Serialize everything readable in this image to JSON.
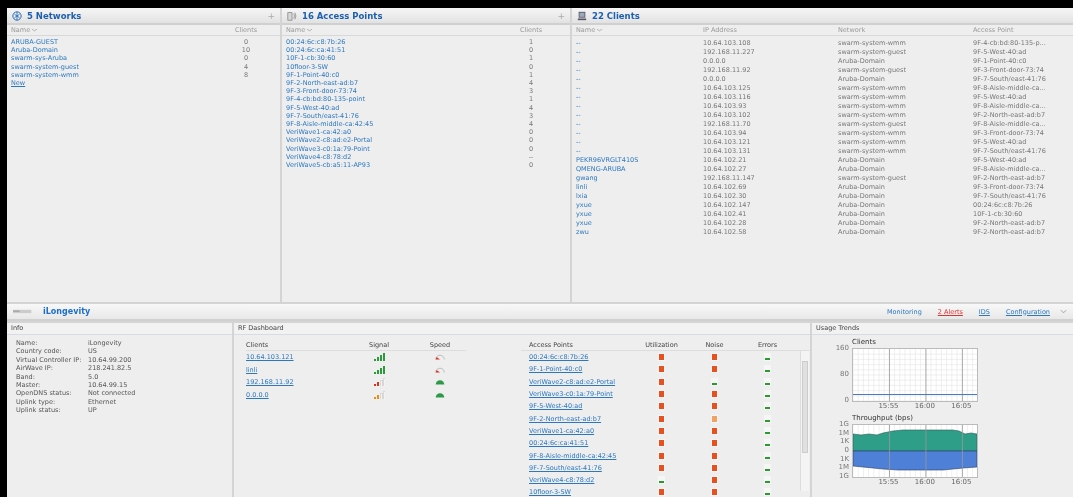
{
  "networks": {
    "title": "5 Networks",
    "add": "+",
    "columns": [
      "Name",
      "Clients"
    ],
    "rows": [
      {
        "name": "ARUBA-GUEST",
        "clients": "0"
      },
      {
        "name": "Aruba-Domain",
        "clients": "10"
      },
      {
        "name": "swarm-sys-Aruba",
        "clients": "0"
      },
      {
        "name": "swarm-system-guest",
        "clients": "4"
      },
      {
        "name": "swarm-system-wmm",
        "clients": "8"
      }
    ],
    "new_link": "New"
  },
  "access_points": {
    "title": "16 Access Points",
    "add": "+",
    "columns": [
      "Name",
      "Clients"
    ],
    "rows": [
      {
        "name": "00:24:6c:c8:7b:26",
        "clients": "1"
      },
      {
        "name": "00:24:6c:ca:41:51",
        "clients": "0"
      },
      {
        "name": "10F-1-cb:30:60",
        "clients": "1"
      },
      {
        "name": "10floor-3-SW",
        "clients": "0"
      },
      {
        "name": "9F-1-Point-40:c0",
        "clients": "1"
      },
      {
        "name": "9F-2-North-east-ad:b7",
        "clients": "4"
      },
      {
        "name": "9F-3-Front-door-73:74",
        "clients": "3"
      },
      {
        "name": "9F-4-cb:bd:80-135-point",
        "clients": "1"
      },
      {
        "name": "9F-5-West-40:ad",
        "clients": "4"
      },
      {
        "name": "9F-7-South/east-41:76",
        "clients": "3"
      },
      {
        "name": "9F-8-Aisle-middle-ca:42:45",
        "clients": "4"
      },
      {
        "name": "VeriWave1-ca:42:a0",
        "clients": "0"
      },
      {
        "name": "VeriWave2-c8:ad:e2-Portal",
        "clients": "0"
      },
      {
        "name": "VeriWave3-c0:1a:79-Point",
        "clients": "0"
      },
      {
        "name": "VeriWave4-c8:78:d2",
        "clients": "--"
      },
      {
        "name": "VeriWave5-cb:a5:11-AP93",
        "clients": "0"
      }
    ]
  },
  "clients": {
    "title": "22 Clients",
    "columns": [
      "Name",
      "IP Address",
      "Network",
      "Access Point"
    ],
    "rows": [
      {
        "name": "--",
        "ip": "10.64.103.108",
        "network": "swarm-system-wmm",
        "access_point": "9F-4-cb:bd:80-135-p..."
      },
      {
        "name": "--",
        "ip": "192.168.11.227",
        "network": "swarm-system-guest",
        "access_point": "9F-5-West-40:ad"
      },
      {
        "name": "--",
        "ip": "0.0.0.0",
        "network": "Aruba-Domain",
        "access_point": "9F-1-Point-40:c0"
      },
      {
        "name": "--",
        "ip": "192.168.11.92",
        "network": "swarm-system-guest",
        "access_point": "9F-3-Front-door-73:74"
      },
      {
        "name": "--",
        "ip": "0.0.0.0",
        "network": "Aruba-Domain",
        "access_point": "9F-7-South/east-41:76"
      },
      {
        "name": "--",
        "ip": "10.64.103.125",
        "network": "swarm-system-wmm",
        "access_point": "9F-8-Aisle-middle-ca..."
      },
      {
        "name": "--",
        "ip": "10.64.103.116",
        "network": "swarm-system-wmm",
        "access_point": "9F-5-West-40:ad"
      },
      {
        "name": "--",
        "ip": "10.64.103.93",
        "network": "swarm-system-wmm",
        "access_point": "9F-8-Aisle-middle-ca..."
      },
      {
        "name": "--",
        "ip": "10.64.103.102",
        "network": "swarm-system-wmm",
        "access_point": "9F-2-North-east-ad:b7"
      },
      {
        "name": "--",
        "ip": "192.168.11.70",
        "network": "swarm-system-guest",
        "access_point": "9F-8-Aisle-middle-ca..."
      },
      {
        "name": "--",
        "ip": "10.64.103.94",
        "network": "swarm-system-wmm",
        "access_point": "9F-3-Front-door-73:74"
      },
      {
        "name": "--",
        "ip": "10.64.103.121",
        "network": "swarm-system-wmm",
        "access_point": "9F-5-West-40:ad"
      },
      {
        "name": "--",
        "ip": "10.64.103.131",
        "network": "swarm-system-wmm",
        "access_point": "9F-7-South/east-41:76"
      },
      {
        "name": "PEKR96VRGLT410S",
        "ip": "10.64.102.21",
        "network": "Aruba-Domain",
        "access_point": "9F-5-West-40:ad"
      },
      {
        "name": "QMENG-ARUBA",
        "ip": "10.64.102.27",
        "network": "Aruba-Domain",
        "access_point": "9F-8-Aisle-middle-ca..."
      },
      {
        "name": "gwang",
        "ip": "192.168.11.147",
        "network": "swarm-system-guest",
        "access_point": "9F-2-North-east-ad:b7"
      },
      {
        "name": "linli",
        "ip": "10.64.102.69",
        "network": "Aruba-Domain",
        "access_point": "9F-3-Front-door-73:74"
      },
      {
        "name": "lxia",
        "ip": "10.64.102.30",
        "network": "Aruba-Domain",
        "access_point": "9F-7-South/east-41:76"
      },
      {
        "name": "yxue",
        "ip": "10.64.102.147",
        "network": "Aruba-Domain",
        "access_point": "00:24:6c:c8:7b:26"
      },
      {
        "name": "yxue",
        "ip": "10.64.102.41",
        "network": "Aruba-Domain",
        "access_point": "10F-1-cb:30:60"
      },
      {
        "name": "yxue",
        "ip": "10.64.102.28",
        "network": "Aruba-Domain",
        "access_point": "9F-2-North-east-ad:b7"
      },
      {
        "name": "zwu",
        "ip": "10.64.102.58",
        "network": "Aruba-Domain",
        "access_point": "9F-2-North-east-ad:b7"
      }
    ]
  },
  "controller": {
    "title": "iLongevity",
    "nav": [
      {
        "label": "Monitoring",
        "selected": true,
        "kind": "link"
      },
      {
        "label": "2 Alerts",
        "selected": false,
        "kind": "alert"
      },
      {
        "label": "IDS",
        "selected": false,
        "kind": "link"
      },
      {
        "label": "Configuration",
        "selected": false,
        "kind": "link"
      }
    ]
  },
  "info": {
    "title": "Info",
    "fields": [
      {
        "label": "Name:",
        "value": "iLongevity"
      },
      {
        "label": "Country code:",
        "value": "US"
      },
      {
        "label": "Virtual Controller IP:",
        "value": "10.64.99.200"
      },
      {
        "label": "AirWave IP:",
        "value": "218.241.82.5"
      },
      {
        "label": "Band:",
        "value": "5.0"
      },
      {
        "label": "Master:",
        "value": "10.64.99.15"
      },
      {
        "label": "OpenDNS status:",
        "value": "Not connected"
      },
      {
        "label": "Uplink type:",
        "value": "Ethernet"
      },
      {
        "label": "Uplink status:",
        "value": "UP"
      }
    ]
  },
  "rf_dashboard": {
    "title": "RF Dashboard",
    "client_columns": [
      "Clients",
      "Signal",
      "Speed"
    ],
    "clients": [
      {
        "name": "10.64.103.121",
        "signal": {
          "strong": true,
          "color": "#2c9a3a"
        },
        "fast": false
      },
      {
        "name": "linli",
        "signal": {
          "strong": true,
          "color": "#2c9a3a"
        },
        "fast": false
      },
      {
        "name": "192.168.11.92",
        "signal": {
          "strong": false,
          "color": "#e03020"
        },
        "fast": true
      },
      {
        "name": "0.0.0.0",
        "signal": {
          "strong": false,
          "color": "#f08a10"
        },
        "fast": true
      }
    ],
    "ap_columns": [
      "Access Points",
      "Utilization",
      "Noise",
      "Errors"
    ],
    "access_points": [
      {
        "name": "00:24:6c:c8:7b:26",
        "utilization": {
          "alarm": true,
          "color": "#e85020"
        },
        "noise": {
          "alarm": true,
          "color": "#e85020"
        },
        "errors": {
          "alarm": false,
          "color": "#2a9a30"
        }
      },
      {
        "name": "9F-1-Point-40:c0",
        "utilization": {
          "alarm": true,
          "color": "#e85020"
        },
        "noise": {
          "alarm": true,
          "color": "#e85020"
        },
        "errors": {
          "alarm": false,
          "color": "#2a9a30"
        }
      },
      {
        "name": "VeriWave2-c8:ad:e2-Portal",
        "utilization": {
          "alarm": true,
          "color": "#e85020"
        },
        "noise": {
          "alarm": false,
          "color": "#2a9a30"
        },
        "errors": {
          "alarm": false,
          "color": "#2a9a30"
        }
      },
      {
        "name": "VeriWave3-c0:1a:79-Point",
        "utilization": {
          "alarm": true,
          "color": "#e85020"
        },
        "noise": {
          "alarm": true,
          "color": "#e85020"
        },
        "errors": {
          "alarm": false,
          "color": "#2a9a30"
        }
      },
      {
        "name": "9F-5-West-40:ad",
        "utilization": {
          "alarm": true,
          "color": "#e85020"
        },
        "noise": {
          "alarm": true,
          "color": "#e85020"
        },
        "errors": {
          "alarm": false,
          "color": "#2a9a30"
        }
      },
      {
        "name": "9F-2-North-east-ad:b7",
        "utilization": {
          "alarm": true,
          "color": "#e85020"
        },
        "noise": {
          "alarm": true,
          "color": "#f4a060"
        },
        "errors": {
          "alarm": false,
          "color": "#2a9a30"
        }
      },
      {
        "name": "VeriWave1-ca:42:a0",
        "utilization": {
          "alarm": true,
          "color": "#e85020"
        },
        "noise": {
          "alarm": true,
          "color": "#e85020"
        },
        "errors": {
          "alarm": false,
          "color": "#2a9a30"
        }
      },
      {
        "name": "00:24:6c:ca:41:51",
        "utilization": {
          "alarm": true,
          "color": "#e85020"
        },
        "noise": {
          "alarm": true,
          "color": "#e85020"
        },
        "errors": {
          "alarm": false,
          "color": "#2a9a30"
        }
      },
      {
        "name": "9F-8-Aisle-middle-ca:42:45",
        "utilization": {
          "alarm": true,
          "color": "#e85020"
        },
        "noise": {
          "alarm": true,
          "color": "#e85020"
        },
        "errors": {
          "alarm": false,
          "color": "#2a9a30"
        }
      },
      {
        "name": "9F-7-South/east-41:76",
        "utilization": {
          "alarm": true,
          "color": "#e85020"
        },
        "noise": {
          "alarm": true,
          "color": "#e85020"
        },
        "errors": {
          "alarm": false,
          "color": "#2a9a30"
        }
      },
      {
        "name": "VeriWave4-c8:78:d2",
        "utilization": {
          "alarm": false,
          "color": "#2a9a30"
        },
        "noise": {
          "alarm": true,
          "color": "#e85020"
        },
        "errors": {
          "alarm": false,
          "color": "#2a9a30"
        }
      },
      {
        "name": "10floor-3-SW",
        "utilization": {
          "alarm": true,
          "color": "#e85020"
        },
        "noise": {
          "alarm": true,
          "color": "#e85020"
        },
        "errors": {
          "alarm": false,
          "color": "#2a9a30"
        }
      }
    ]
  },
  "usage_trends": {
    "title": "Usage Trends",
    "clients_chart": {
      "chart_data": {
        "type": "line",
        "title": "Clients",
        "categories": [
          null,
          null,
          null,
          null,
          null,
          "15:55",
          null,
          null,
          null,
          null,
          "16:00",
          null,
          null,
          null,
          null,
          "16:05",
          null,
          null
        ],
        "series": [
          {
            "color": "#4a78c8",
            "values": [
              20,
              20,
              20,
              20,
              20,
              20,
              20,
              20,
              20,
              20,
              20,
              20,
              20,
              20,
              20,
              20,
              20,
              20
            ]
          }
        ],
        "ylim": [
          0,
          160
        ],
        "yticks": [
          0,
          80,
          160
        ],
        "grid": true
      }
    },
    "throughput": {
      "title": "Throughput  (bps)",
      "y_labels": [
        "1G",
        "1M",
        "1K",
        "0",
        "1K",
        "1M",
        "1G"
      ],
      "x_labels": [
        "15:55",
        "16:00",
        "16:05"
      ]
    }
  }
}
